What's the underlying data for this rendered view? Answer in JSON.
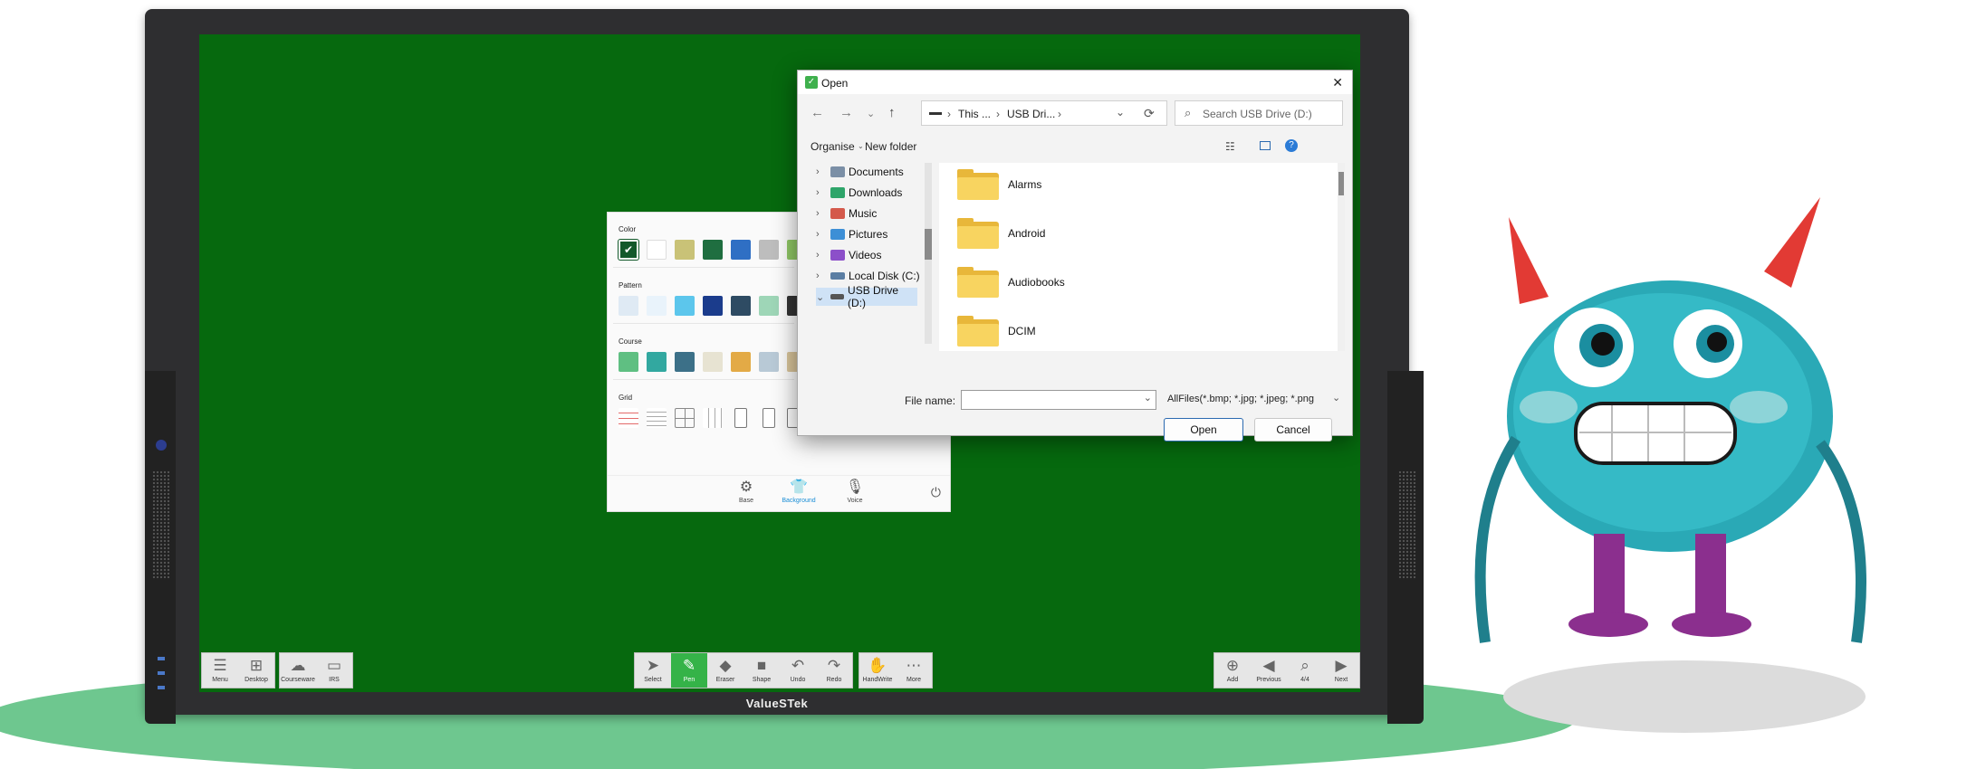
{
  "display": {
    "brand": "ValueSTek"
  },
  "toolbar": {
    "left": [
      {
        "icon": "menu-icon",
        "label": "Menu"
      },
      {
        "icon": "windows-icon",
        "label": "Desktop"
      },
      {
        "icon": "cloud-icon",
        "label": "Courseware"
      },
      {
        "icon": "wifi-screen-icon",
        "label": "IRS"
      }
    ],
    "center": [
      {
        "icon": "cursor-icon",
        "label": "Select"
      },
      {
        "icon": "pen-icon",
        "label": "Pen",
        "active": true
      },
      {
        "icon": "eraser-icon",
        "label": "Eraser"
      },
      {
        "icon": "shape-icon",
        "label": "Shape"
      },
      {
        "icon": "undo-icon",
        "label": "Undo"
      },
      {
        "icon": "redo-icon",
        "label": "Redo"
      },
      {
        "icon": "hand-icon",
        "label": "HandWrite"
      },
      {
        "icon": "more-icon",
        "label": "More"
      }
    ],
    "right": [
      {
        "icon": "add-page-icon",
        "label": "Add"
      },
      {
        "icon": "previous-icon",
        "label": "Previous"
      },
      {
        "icon": "page-count-icon",
        "label": "4/4"
      },
      {
        "icon": "next-icon",
        "label": "Next"
      }
    ]
  },
  "background_panel": {
    "sections": {
      "color": "Color",
      "pattern": "Pattern",
      "course": "Course",
      "grid": "Grid"
    },
    "colors": [
      "#13592b",
      "#ffffff",
      "#c9c277",
      "#1f6e40",
      "#2f6fc4",
      "#bdbdbd",
      "#8fc765"
    ],
    "footer": [
      {
        "icon": "gear-icon",
        "label": "Base"
      },
      {
        "icon": "shirt-icon",
        "label": "Background",
        "active": true
      },
      {
        "icon": "mic-icon",
        "label": "Voice"
      }
    ]
  },
  "dialog": {
    "title": "Open",
    "address": [
      "This ...",
      "USB Dri..."
    ],
    "search_placeholder": "Search USB Drive (D:)",
    "organise": "Organise",
    "new_folder": "New folder",
    "tree": [
      "Documents",
      "Downloads",
      "Music",
      "Pictures",
      "Videos",
      "Local Disk (C:)",
      "USB Drive (D:)"
    ],
    "files": [
      "Alarms",
      "Android",
      "Audiobooks",
      "DCIM"
    ],
    "file_name_label": "File name:",
    "file_name_value": "",
    "filter": "AllFiles(*.bmp; *.jpg; *.jpeg; *.png",
    "open_label": "Open",
    "cancel_label": "Cancel"
  }
}
